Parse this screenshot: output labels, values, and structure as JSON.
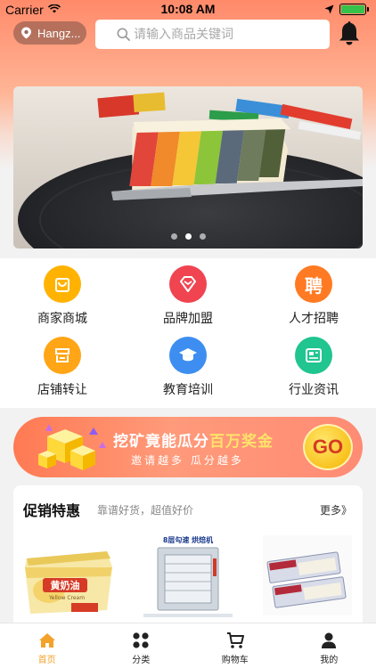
{
  "status_bar": {
    "carrier": "Carrier",
    "time": "10:08 AM"
  },
  "header": {
    "city": "Hangz...",
    "search_placeholder": "请输入商品关键词"
  },
  "banner": {
    "dot_count": 3,
    "active_dot": 1
  },
  "grid": {
    "items": [
      {
        "label": "商家商城",
        "icon": "shopping-bag-icon",
        "color": "#ffb300"
      },
      {
        "label": "品牌加盟",
        "icon": "diamond-icon",
        "color": "#f04451"
      },
      {
        "label": "人才招聘",
        "icon": "recruit-icon",
        "glyph": "聘",
        "color": "#ff7a22"
      },
      {
        "label": "店铺转让",
        "icon": "store-icon",
        "color": "#ffa516"
      },
      {
        "label": "教育培训",
        "icon": "graduation-cap-icon",
        "color": "#3d8ef0"
      },
      {
        "label": "行业资讯",
        "icon": "news-icon",
        "color": "#20c58f"
      }
    ]
  },
  "promo": {
    "title_prefix": "挖矿竟能瓜分",
    "title_highlight": "百万奖金",
    "subtitle": "邀请越多 瓜分越多",
    "go_label": "GO"
  },
  "promotions": {
    "title": "促销特惠",
    "subtitle": "靠谱好货，超值好价",
    "more_label": "更多》",
    "products": [
      {
        "name": "butter-tub",
        "text_main": "黄奶油",
        "text_sub": "Yellow Cream"
      },
      {
        "name": "baking-oven",
        "text_main": "8层勾速 烘焙机"
      },
      {
        "name": "cheese-packs"
      }
    ]
  },
  "tabbar": {
    "tabs": [
      {
        "label": "首页",
        "icon": "home-icon",
        "active": true
      },
      {
        "label": "分类",
        "icon": "category-icon",
        "active": false
      },
      {
        "label": "购物车",
        "icon": "cart-icon",
        "active": false
      },
      {
        "label": "我的",
        "icon": "profile-icon",
        "active": false
      }
    ]
  },
  "colors": {
    "accent": "#ff8a6a",
    "tab_active": "#f3a22a",
    "highlight": "#ffe36a"
  }
}
